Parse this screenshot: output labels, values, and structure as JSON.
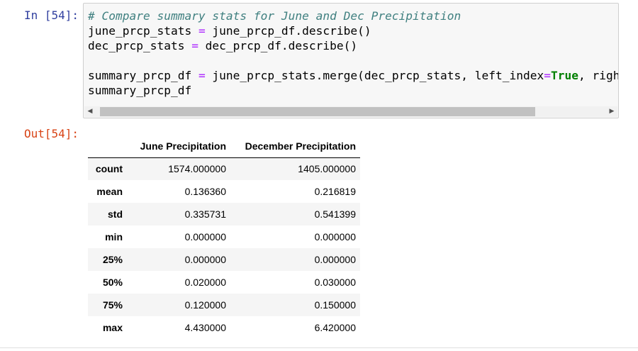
{
  "cell": {
    "in_prompt": "In [54]:",
    "out_prompt": "Out[54]:",
    "code": {
      "comment": "# Compare summary stats for June and Dec Precipitation",
      "line2_a": "june_prcp_stats ",
      "line2_op": "=",
      "line2_b": " june_prcp_df.describe()",
      "line3_a": "dec_prcp_stats ",
      "line3_op": "=",
      "line3_b": " dec_prcp_df.describe()",
      "line5_a": "summary_prcp_df ",
      "line5_op": "=",
      "line5_b": " june_prcp_stats.merge(dec_prcp_stats, left_index",
      "line5_op2": "=",
      "line5_kw": "True",
      "line5_c": ", right_",
      "line6": "summary_prcp_df"
    },
    "scrollbar": {
      "left_arrow": "◀",
      "right_arrow": "▶"
    }
  },
  "table": {
    "columns": [
      "",
      "June Precipitation",
      "December Precipitation"
    ],
    "rows": [
      {
        "index": "count",
        "june": "1574.000000",
        "dec": "1405.000000"
      },
      {
        "index": "mean",
        "june": "0.136360",
        "dec": "0.216819"
      },
      {
        "index": "std",
        "june": "0.335731",
        "dec": "0.541399"
      },
      {
        "index": "min",
        "june": "0.000000",
        "dec": "0.000000"
      },
      {
        "index": "25%",
        "june": "0.000000",
        "dec": "0.000000"
      },
      {
        "index": "50%",
        "june": "0.020000",
        "dec": "0.030000"
      },
      {
        "index": "75%",
        "june": "0.120000",
        "dec": "0.150000"
      },
      {
        "index": "max",
        "june": "4.430000",
        "dec": "6.420000"
      }
    ]
  },
  "colors": {
    "in_prompt": "#303f9f",
    "out_prompt": "#d84315",
    "comment": "#408080",
    "operator": "#aa22ff",
    "keyword": "#008000",
    "input_background": "#f7f7f7",
    "row_stripe": "#f5f5f5"
  }
}
